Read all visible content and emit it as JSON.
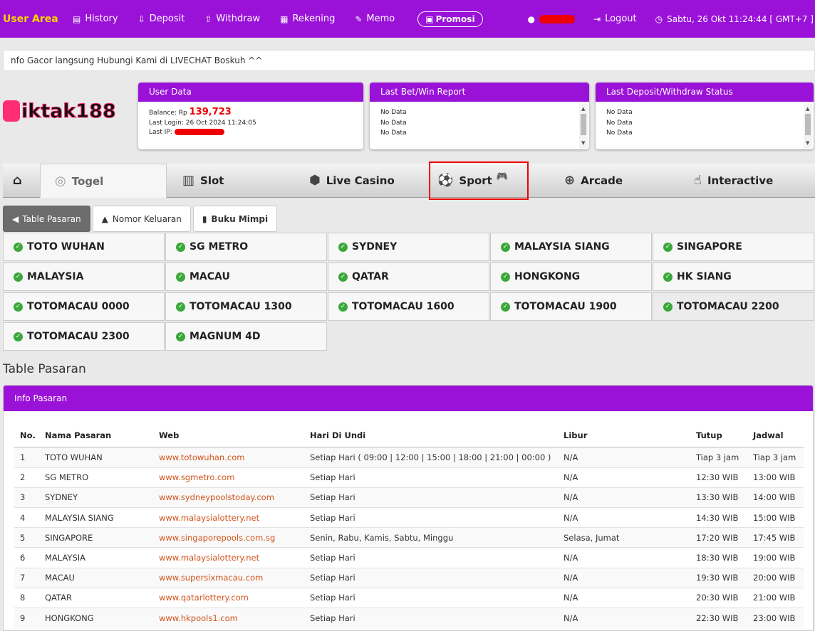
{
  "topbar": {
    "brand": "User Area",
    "nav": [
      {
        "icon": "history-icon",
        "glyph": "▤",
        "label": "History"
      },
      {
        "icon": "deposit-icon",
        "glyph": "⇩",
        "label": "Deposit"
      },
      {
        "icon": "withdraw-icon",
        "glyph": "⇧",
        "label": "Withdraw"
      },
      {
        "icon": "rekening-icon",
        "glyph": "▦",
        "label": "Rekening"
      },
      {
        "icon": "memo-icon",
        "glyph": "✎",
        "label": "Memo"
      }
    ],
    "promo_label": "Promosi",
    "logout_label": "Logout",
    "datetime": "Sabtu, 26 Okt 11:24:44 [ GMT+7 ]"
  },
  "marquee": "nfo Gacor langsung Hubungi Kami di LIVECHAT Boskuh ^^",
  "logo": "iktak188",
  "user_data": {
    "title": "User Data",
    "balance_label": "Balance: Rp",
    "balance_value": "139,723",
    "last_login": "Last Login: 26 Oct 2024 11:24:05",
    "last_ip_label": "Last IP:"
  },
  "bet_report": {
    "title": "Last Bet/Win Report",
    "rows": [
      "No Data",
      "No Data",
      "No Data"
    ]
  },
  "deposit_status": {
    "title": "Last Deposit/Withdraw Status",
    "rows": [
      "No Data",
      "No Data",
      "No Data"
    ]
  },
  "categories": {
    "togel": "Togel",
    "slot": "Slot",
    "live_casino": "Live Casino",
    "sport": "Sport",
    "arcade": "Arcade",
    "interactive": "Interactive"
  },
  "subtabs": {
    "table_pasaran": "Table Pasaran",
    "nomor_keluaran": "Nomor Keluaran",
    "buku_mimpi": "Buku Mimpi"
  },
  "markets": [
    "TOTO WUHAN",
    "SG METRO",
    "SYDNEY",
    "MALAYSIA SIANG",
    "SINGAPORE",
    "MALAYSIA",
    "MACAU",
    "QATAR",
    "HONGKONG",
    "HK SIANG",
    "TOTOMACAU 0000",
    "TOTOMACAU 1300",
    "TOTOMACAU 1600",
    "TOTOMACAU 1900",
    "TOTOMACAU 2200",
    "TOTOMACAU 2300",
    "MAGNUM 4D"
  ],
  "section_title": "Table Pasaran",
  "info_card": {
    "title": "Info Pasaran",
    "headers": [
      "No.",
      "Nama Pasaran",
      "Web",
      "Hari Di Undi",
      "Libur",
      "Tutup",
      "Jadwal"
    ],
    "rows": [
      [
        "1",
        "TOTO WUHAN",
        "www.totowuhan.com",
        "Setiap Hari ( 09:00 | 12:00 | 15:00 | 18:00 | 21:00 | 00:00 )",
        "N/A",
        "Tiap 3 jam",
        "Tiap 3 jam"
      ],
      [
        "2",
        "SG METRO",
        "www.sgmetro.com",
        "Setiap Hari",
        "N/A",
        "12:30 WIB",
        "13:00 WIB"
      ],
      [
        "3",
        "SYDNEY",
        "www.sydneypoolstoday.com",
        "Setiap Hari",
        "N/A",
        "13:30 WIB",
        "14:00 WIB"
      ],
      [
        "4",
        "MALAYSIA SIANG",
        "www.malaysialottery.net",
        "Setiap Hari",
        "N/A",
        "14:30 WIB",
        "15:00 WIB"
      ],
      [
        "5",
        "SINGAPORE",
        "www.singaporepools.com.sg",
        "Senin, Rabu, Kamis, Sabtu, Minggu",
        "Selasa, Jumat",
        "17:20 WIB",
        "17:45 WIB"
      ],
      [
        "6",
        "MALAYSIA",
        "www.malaysialottery.net",
        "Setiap Hari",
        "N/A",
        "18:30 WIB",
        "19:00 WIB"
      ],
      [
        "7",
        "MACAU",
        "www.supersixmacau.com",
        "Setiap Hari",
        "N/A",
        "19:30 WIB",
        "20:00 WIB"
      ],
      [
        "8",
        "QATAR",
        "www.qatarlottery.com",
        "Setiap Hari",
        "N/A",
        "20:30 WIB",
        "21:00 WIB"
      ],
      [
        "9",
        "HONGKONG",
        "www.hkpools1.com",
        "Setiap Hari",
        "N/A",
        "22:30 WIB",
        "23:00 WIB"
      ]
    ]
  }
}
